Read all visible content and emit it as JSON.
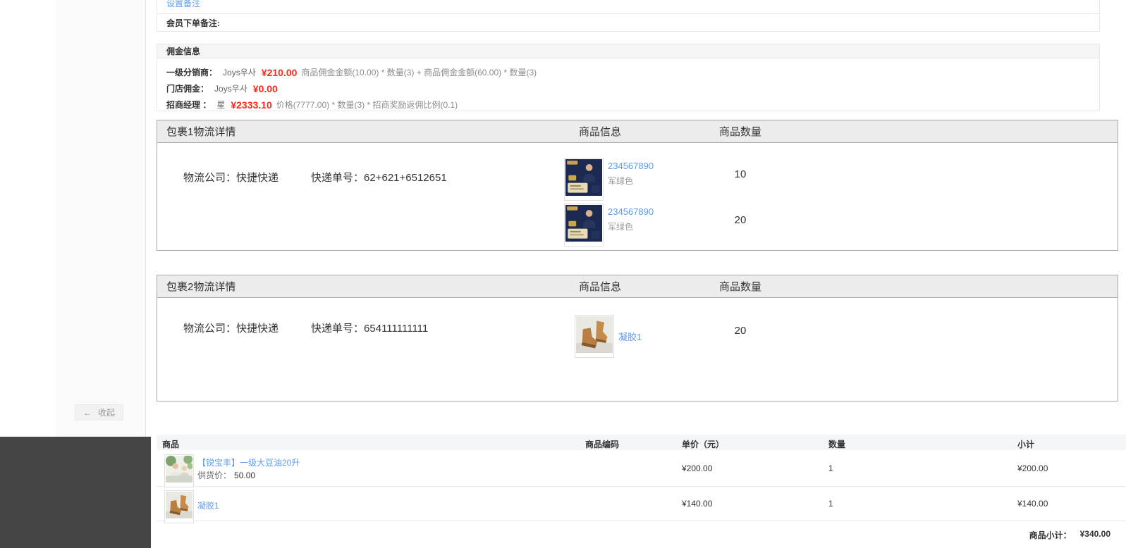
{
  "sidebar": {
    "collapse_arrow": "←",
    "collapse_label": "收起"
  },
  "note_section": {
    "set_remark_link": "设置备注",
    "member_note_label": "会员下单备注:"
  },
  "commission": {
    "title": "佣金信息",
    "rows": [
      {
        "label": "一级分销商：",
        "name": "Joys우사",
        "amount": "¥210.00",
        "formula": "商品佣金金额(10.00) * 数量(3) + 商品佣金金额(60.00) * 数量(3)"
      },
      {
        "label": "门店佣金：",
        "name": "Joys우사",
        "amount": "¥0.00",
        "formula": ""
      },
      {
        "label": "招商经理 ：",
        "name": "星",
        "amount": "¥2333.10",
        "formula": "价格(7777.00) * 数量(3) * 招商奖励返佣比例(0.1)"
      }
    ]
  },
  "packages": [
    {
      "title": "包裹1物流详情",
      "product_col": "商品信息",
      "qty_col": "商品数量",
      "company_label": "物流公司：",
      "company": "快捷快递",
      "tracking_label": "快递单号：",
      "tracking": "62+621+6512651",
      "items": [
        {
          "name": "234567890",
          "spec": "军绿色",
          "qty": "10",
          "image": "course-banner-thumbnail"
        },
        {
          "name": "234567890",
          "spec": "军绿色",
          "qty": "20",
          "image": "course-banner-thumbnail"
        }
      ]
    },
    {
      "title": "包裹2物流详情",
      "product_col": "商品信息",
      "qty_col": "商品数量",
      "company_label": "物流公司：",
      "company": "快捷快递",
      "tracking_label": "快递单号：",
      "tracking": "654111111111",
      "items": [
        {
          "name": "凝胶1",
          "spec": "",
          "qty": "20",
          "image": "boots-thumbnail"
        }
      ]
    }
  ],
  "order_table": {
    "headers": {
      "product": "商品",
      "code": "商品编码",
      "price": "单价（元）",
      "qty": "数量",
      "subtotal": "小计"
    },
    "rows": [
      {
        "name": "【锐宝丰】一级大豆油20升",
        "supply_label": "供货价：",
        "supply_price": "50.00",
        "price": "¥200.00",
        "qty": "1",
        "subtotal": "¥200.00",
        "image": "soybean-oil-thumbnail"
      },
      {
        "name": "凝胶1",
        "supply_label": "",
        "supply_price": "",
        "price": "¥140.00",
        "qty": "1",
        "subtotal": "¥140.00",
        "image": "boots-thumbnail"
      }
    ],
    "summary_label": "商品小计：",
    "summary_value": "¥340.00"
  },
  "colors": {
    "link_blue": "#5a9cf2",
    "price_red": "#f52c1c"
  }
}
